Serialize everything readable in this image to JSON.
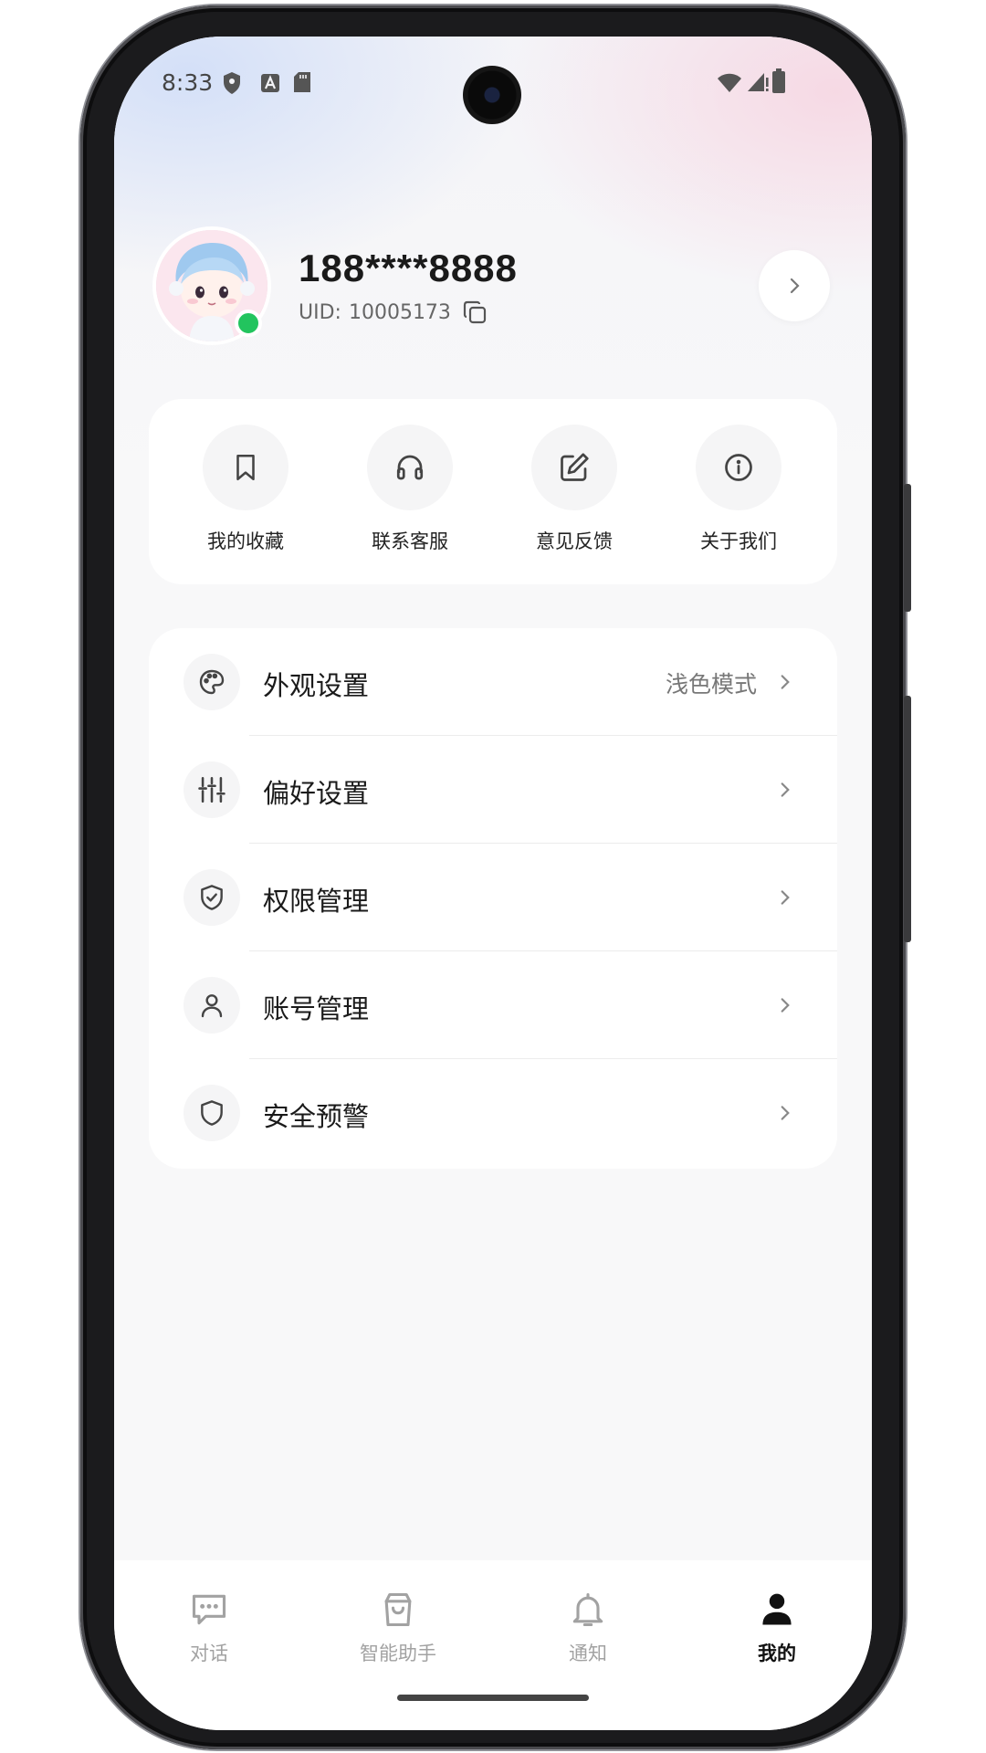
{
  "status_bar": {
    "time": "8:33",
    "left_icons": [
      "shield-icon",
      "a-badge-icon",
      "sd-card-icon"
    ],
    "right_icons": [
      "wifi-icon",
      "signal-icon",
      "battery-icon"
    ]
  },
  "profile": {
    "phone_number": "188****8888",
    "uid_label": "UID:",
    "uid_value": "10005173",
    "online": true,
    "online_color": "#22c45e"
  },
  "quick_actions": [
    {
      "label": "我的收藏",
      "icon": "bookmark-icon"
    },
    {
      "label": "联系客服",
      "icon": "headphones-icon"
    },
    {
      "label": "意见反馈",
      "icon": "edit-icon"
    },
    {
      "label": "关于我们",
      "icon": "info-icon"
    }
  ],
  "settings": [
    {
      "label": "外观设置",
      "value": "浅色模式",
      "icon": "palette-icon"
    },
    {
      "label": "偏好设置",
      "value": "",
      "icon": "sliders-icon"
    },
    {
      "label": "权限管理",
      "value": "",
      "icon": "shield-check-icon"
    },
    {
      "label": "账号管理",
      "value": "",
      "icon": "user-icon"
    },
    {
      "label": "安全预警",
      "value": "",
      "icon": "shield-icon"
    }
  ],
  "tabbar": {
    "active_index": 3,
    "tabs": [
      {
        "label": "对话",
        "icon": "chat-icon"
      },
      {
        "label": "智能助手",
        "icon": "shopping-bag-icon"
      },
      {
        "label": "通知",
        "icon": "bell-icon"
      },
      {
        "label": "我的",
        "icon": "person-icon"
      }
    ]
  }
}
